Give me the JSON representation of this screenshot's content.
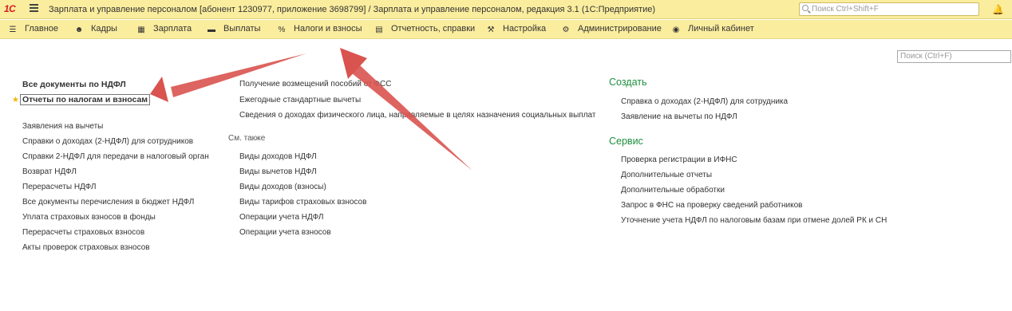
{
  "titlebar": {
    "logo": "1С",
    "title": "Зарплата и управление персоналом [абонент 1230977, приложение 3698799] / Зарплата и управление персоналом, редакция 3.1  (1С:Предприятие)",
    "search_placeholder": "Поиск Ctrl+Shift+F"
  },
  "menu": [
    {
      "label": "Главное",
      "icon": "hamburger-icon"
    },
    {
      "label": "Кадры",
      "icon": "people-icon"
    },
    {
      "label": "Зарплата",
      "icon": "calculator-icon"
    },
    {
      "label": "Выплаты",
      "icon": "wallet-icon"
    },
    {
      "label": "Налоги и взносы",
      "icon": "percent-icon"
    },
    {
      "label": "Отчетность, справки",
      "icon": "reports-icon"
    },
    {
      "label": "Настройка",
      "icon": "wrench-icon"
    },
    {
      "label": "Администрирование",
      "icon": "gear-icon"
    },
    {
      "label": "Личный кабинет",
      "icon": "user-circle-icon"
    }
  ],
  "content": {
    "search_placeholder": "Поиск (Ctrl+F)",
    "col1": {
      "header_links": [
        "Все документы по НДФЛ",
        "Отчеты по налогам и взносам"
      ],
      "links": [
        "Заявления на вычеты",
        "Справки о доходах (2-НДФЛ) для сотрудников",
        "Справки 2-НДФЛ для передачи в налоговый орган",
        "Возврат НДФЛ",
        "Перерасчеты НДФЛ",
        "Все документы перечисления в бюджет НДФЛ",
        "Уплата страховых взносов в фонды",
        "Перерасчеты страховых взносов",
        "Акты проверок страховых взносов"
      ]
    },
    "col2": {
      "links": [
        "Получение возмещений пособий от ФСС",
        "Ежегодные стандартные вычеты",
        "Сведения о доходах физического лица, направляемые в целях назначения социальных выплат"
      ],
      "see_also_label": "См. также",
      "see_also_links": [
        "Виды доходов НДФЛ",
        "Виды вычетов НДФЛ",
        "Виды доходов (взносы)",
        "Виды тарифов страховых взносов",
        "Операции учета НДФЛ",
        "Операции учета взносов"
      ]
    },
    "col3": {
      "create_label": "Создать",
      "create_links": [
        "Справка о доходах (2-НДФЛ) для сотрудника",
        "Заявление на вычеты по НДФЛ"
      ],
      "service_label": "Сервис",
      "service_links": [
        "Проверка регистрации в ИФНС",
        "Дополнительные отчеты",
        "Дополнительные обработки",
        "Запрос в ФНС на проверку сведений работников",
        "Уточнение учета НДФЛ по налоговым базам при отмене долей РК и СН"
      ]
    }
  },
  "colors": {
    "toolbar_bg": "#fbed9e",
    "section_green": "#1e8e3e",
    "annotation_red": "#d9534f",
    "logo_red": "#d7191f"
  }
}
